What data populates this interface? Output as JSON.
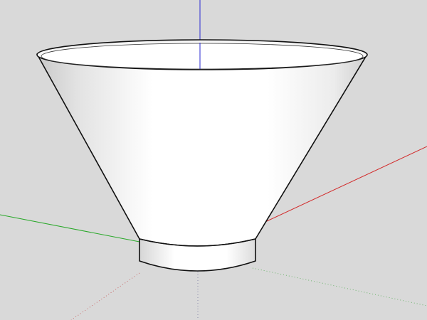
{
  "viewport": {
    "background_color": "#d9d9d9",
    "edge_color": "#111111",
    "face_color": "#ffffff",
    "shade_color": "#c8c8c8"
  },
  "axes": {
    "red_color": "#d22a2a",
    "green_color": "#28a828",
    "blue_color": "#2a2ad2"
  },
  "model": {
    "shape": "truncated cone bowl with cylindrical base"
  }
}
